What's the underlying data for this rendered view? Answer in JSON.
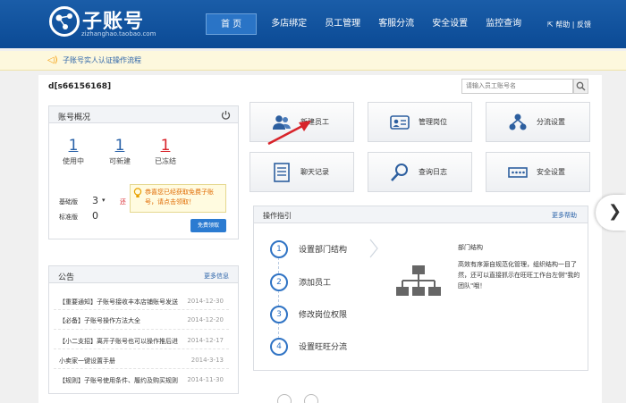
{
  "header": {
    "brand": "子账号",
    "domain": "zizhanghao.taobao.com",
    "nav": [
      "首 页",
      "多店绑定",
      "员工管理",
      "客服分流",
      "安全设置",
      "监控查询"
    ],
    "help": "帮助 | 反馈"
  },
  "notice": {
    "text": "子账号实人认证操作流程"
  },
  "account": {
    "id": "d[s66156168]"
  },
  "search": {
    "placeholder": "请输入员工账号名"
  },
  "overview": {
    "title": "账号概况",
    "stats": [
      {
        "value": "1",
        "label": "使用中",
        "color": "#2a62a8"
      },
      {
        "value": "1",
        "label": "可新建",
        "color": "#2a62a8"
      },
      {
        "value": "1",
        "label": "已冻结",
        "color": "#d8232a"
      }
    ],
    "basic_label": "基础版",
    "basic_value": "3",
    "basic_extra": "还",
    "std_label": "标准版",
    "std_value": "0",
    "tip": "恭喜您已经获取免费子账号，请点击领取！",
    "free_button": "免费领取"
  },
  "announcements": {
    "title": "公告",
    "more": "更多信息",
    "items": [
      {
        "text": "【重要通知】子账号接收丰本店铺账号发送",
        "date": "2014-12-30"
      },
      {
        "text": "【必备】子账号操作方法大全",
        "date": "2014-12-20"
      },
      {
        "text": "【小二支招】离开子账号也可以操作推后进",
        "date": "2014-12-17"
      },
      {
        "text": "小卖家一键设置手册",
        "date": "2014-3-13"
      },
      {
        "text": "【规则】子账号使用条件、履约及购买规则",
        "date": "2014-11-30"
      }
    ]
  },
  "quick_actions": [
    {
      "label": "新建员工",
      "icon": "users-icon"
    },
    {
      "label": "管理岗位",
      "icon": "id-card-icon"
    },
    {
      "label": "分流设置",
      "icon": "network-icon"
    },
    {
      "label": "聊天记录",
      "icon": "document-icon"
    },
    {
      "label": "查询日志",
      "icon": "magnifier-icon"
    },
    {
      "label": "安全设置",
      "icon": "password-icon"
    }
  ],
  "guide": {
    "title": "操作指引",
    "more": "更多帮助",
    "steps": [
      "设置部门结构",
      "添加员工",
      "修改岗位权限",
      "设置旺旺分流"
    ],
    "detail_title": "部门结构",
    "detail_text": "高效有序源自规范化管理，组织结构一目了然，还可以直接抓示在旺旺工作台左侧\"我的团队\"哦！"
  },
  "colors": {
    "header": "#0b4a95",
    "accent": "#2f73c4",
    "alert": "#d8232a"
  }
}
